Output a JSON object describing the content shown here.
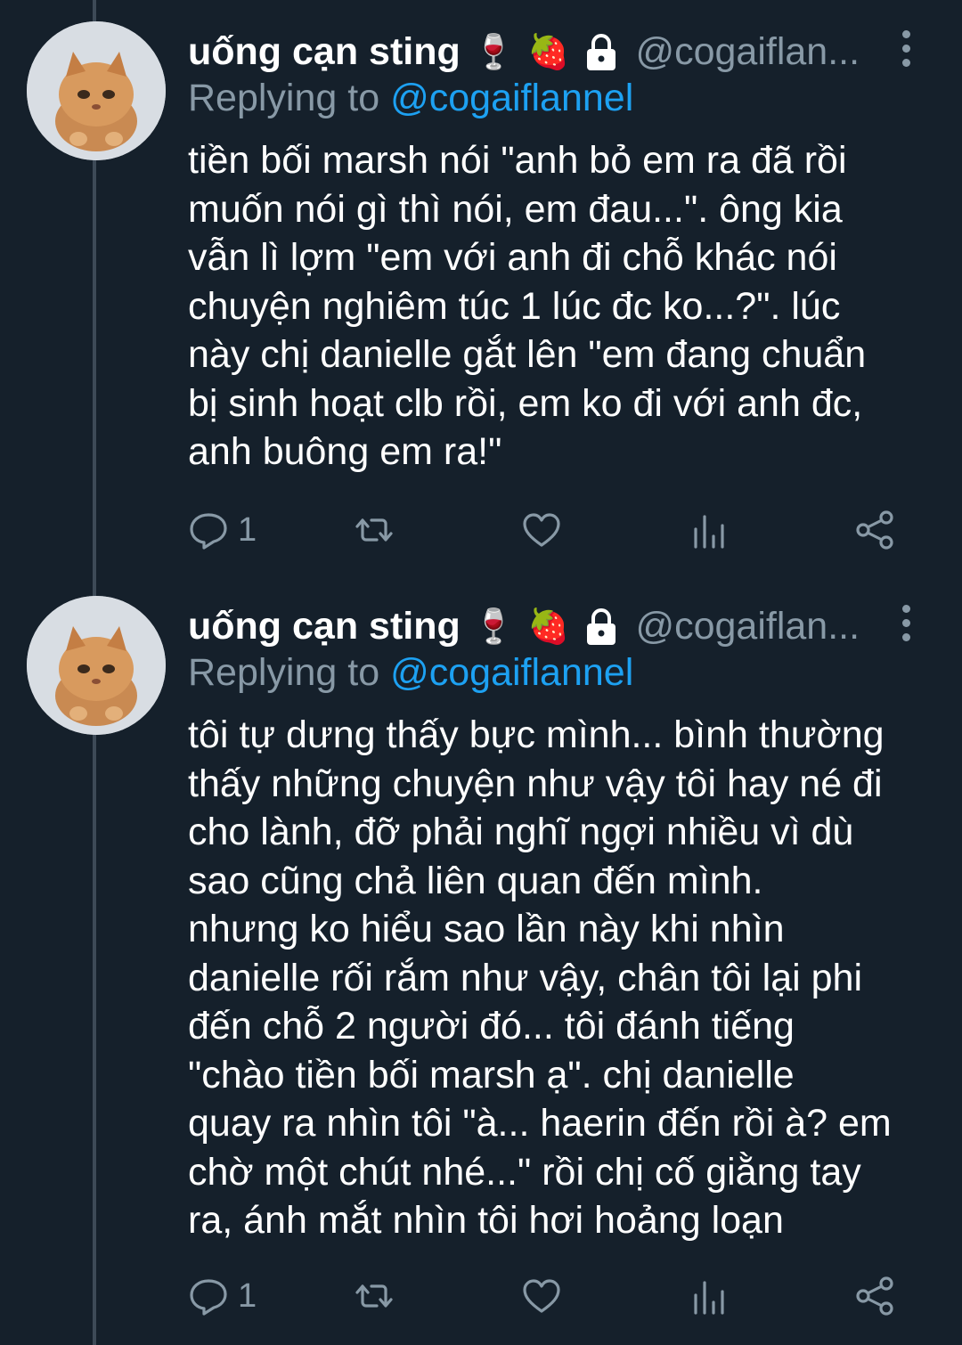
{
  "thread": [
    {
      "display_name": "uống cạn sting",
      "emojis": [
        "🍷",
        "🍓"
      ],
      "handle": "@cogaiflan...",
      "replying_prefix": "Replying to",
      "replying_mention": "@cogaiflannel",
      "body_lines": [
        "tiền bối marsh nói \"anh bỏ em ra đã rồi",
        "muốn nói gì thì nói, em đau...\". ông kia",
        "vẫn lì lợm \"em với anh đi chỗ khác nói",
        "chuyện nghiêm túc 1 lúc đc ko...?\". lúc",
        "này chị danielle gắt lên \"em đang chuẩn",
        "bị sinh hoạt clb rồi, em ko đi với anh đc,",
        "anh buông em ra!\""
      ],
      "reply_count": "1"
    },
    {
      "display_name": "uống cạn sting",
      "emojis": [
        "🍷",
        "🍓"
      ],
      "handle": "@cogaiflan...",
      "replying_prefix": "Replying to",
      "replying_mention": "@cogaiflannel",
      "body_lines": [
        "tôi tự dưng thấy bực mình... bình thường",
        "thấy những chuyện như vậy tôi hay né đi",
        "cho lành, đỡ phải nghĩ ngợi nhiều vì dù",
        "sao cũng chả liên quan đến mình.",
        "nhưng ko hiểu sao lần này khi nhìn",
        "danielle rối rắm như vậy, chân tôi lại phi",
        "đến chỗ 2 người đó... tôi đánh tiếng",
        "\"chào tiền bối marsh ạ\". chị danielle",
        "quay ra nhìn tôi \"à... haerin đến rồi à? em",
        "chờ một chút nhé...\" rồi chị cố giằng tay",
        "ra, ánh mắt nhìn tôi hơi hoảng loạn"
      ],
      "reply_count": "1"
    }
  ],
  "icons": {
    "reply": "reply-icon",
    "retweet": "retweet-icon",
    "like": "heart-icon",
    "analytics": "analytics-icon",
    "share": "share-icon",
    "more": "more-vertical-icon",
    "protected": "lock-icon"
  },
  "colors": {
    "background": "#15202b",
    "secondary_text": "#8899a6",
    "link": "#1da1f2",
    "thread_line": "#3d4a57"
  }
}
